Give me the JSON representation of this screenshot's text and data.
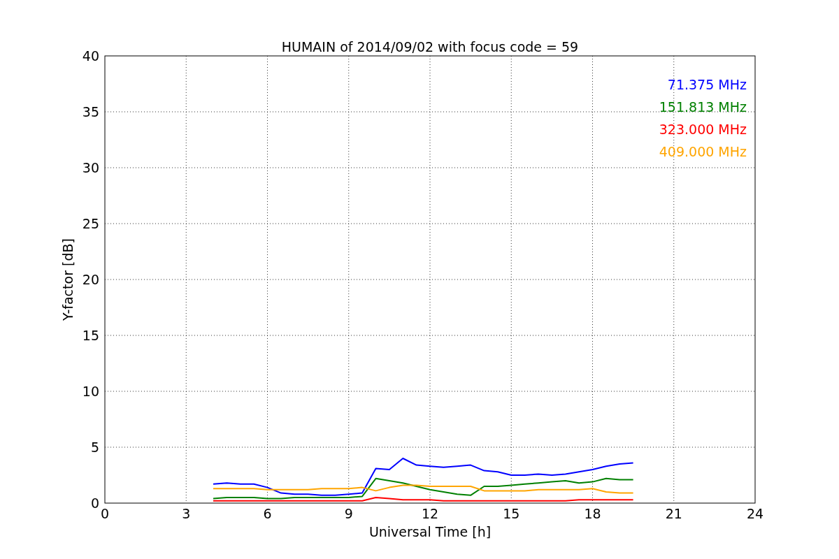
{
  "chart_data": {
    "type": "line",
    "title": "HUMAIN of 2014/09/02 with focus code = 59",
    "xlabel": "Universal Time [h]",
    "ylabel": "Y-factor [dB]",
    "x": [
      4,
      4.5,
      5,
      5.5,
      6,
      6.5,
      7,
      7.5,
      8,
      8.5,
      9,
      9.5,
      10,
      10.5,
      11,
      11.5,
      12,
      12.5,
      13,
      13.5,
      14,
      14.5,
      15,
      15.5,
      16,
      16.5,
      17,
      17.5,
      18,
      18.5,
      19,
      19.5
    ],
    "series": [
      {
        "name": "71.375 MHz",
        "color": "#0000ff",
        "values": [
          1.7,
          1.8,
          1.7,
          1.7,
          1.4,
          0.9,
          0.8,
          0.8,
          0.7,
          0.7,
          0.8,
          0.9,
          3.1,
          3.0,
          4.0,
          3.4,
          3.3,
          3.2,
          3.3,
          3.4,
          2.9,
          2.8,
          2.5,
          2.5,
          2.6,
          2.5,
          2.6,
          2.8,
          3.0,
          3.3,
          3.5,
          3.6
        ]
      },
      {
        "name": "151.813 MHz",
        "color": "#008000",
        "values": [
          0.4,
          0.5,
          0.5,
          0.5,
          0.4,
          0.4,
          0.5,
          0.5,
          0.5,
          0.5,
          0.5,
          0.6,
          2.2,
          2.0,
          1.8,
          1.5,
          1.2,
          1.0,
          0.8,
          0.7,
          1.5,
          1.5,
          1.6,
          1.7,
          1.8,
          1.9,
          2.0,
          1.8,
          1.9,
          2.2,
          2.1,
          2.1
        ]
      },
      {
        "name": "323.000 MHz",
        "color": "#ff0000",
        "values": [
          0.2,
          0.2,
          0.2,
          0.2,
          0.2,
          0.2,
          0.2,
          0.2,
          0.2,
          0.2,
          0.2,
          0.2,
          0.5,
          0.4,
          0.3,
          0.3,
          0.3,
          0.2,
          0.2,
          0.2,
          0.2,
          0.2,
          0.2,
          0.2,
          0.2,
          0.2,
          0.2,
          0.3,
          0.3,
          0.3,
          0.3,
          0.3
        ]
      },
      {
        "name": "409.000 MHz",
        "color": "#ffa500",
        "values": [
          1.3,
          1.3,
          1.3,
          1.3,
          1.2,
          1.2,
          1.2,
          1.2,
          1.3,
          1.3,
          1.3,
          1.4,
          1.1,
          1.4,
          1.6,
          1.6,
          1.5,
          1.5,
          1.5,
          1.5,
          1.1,
          1.1,
          1.1,
          1.1,
          1.2,
          1.2,
          1.2,
          1.2,
          1.3,
          1.0,
          0.9,
          0.9
        ]
      }
    ],
    "xlim": [
      0,
      24
    ],
    "ylim": [
      0,
      40
    ],
    "xticks": [
      0,
      3,
      6,
      9,
      12,
      15,
      18,
      21,
      24
    ],
    "yticks": [
      0,
      5,
      10,
      15,
      20,
      25,
      30,
      35,
      40
    ],
    "grid": true
  }
}
